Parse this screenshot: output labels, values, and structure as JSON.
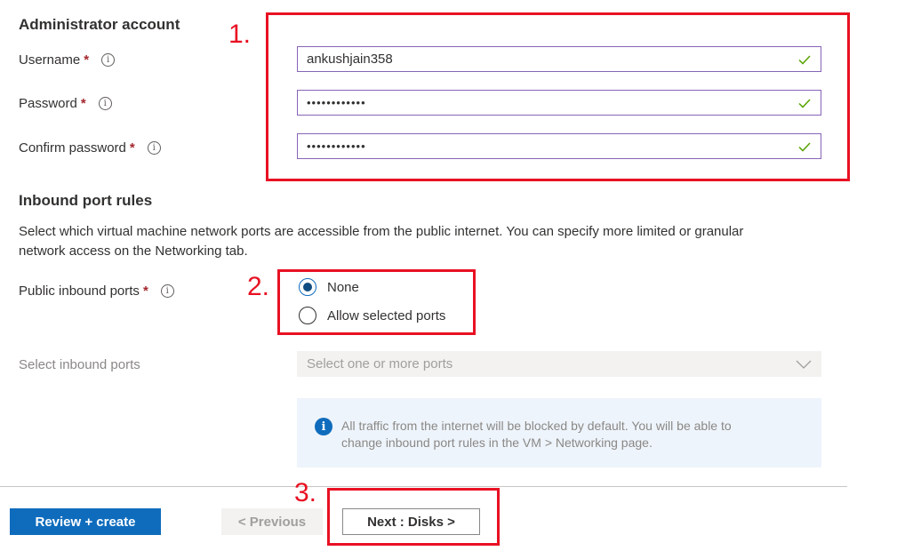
{
  "admin_account": {
    "title": "Administrator account",
    "username_label": "Username",
    "password_label": "Password",
    "confirm_label": "Confirm password",
    "required_mark": "*",
    "info_glyph": "i",
    "username_value": "ankushjain358",
    "password_value": "••••••••••••",
    "confirm_value": "••••••••••••",
    "valid_icon": "check-icon"
  },
  "inbound": {
    "title": "Inbound port rules",
    "description_line1": "Select which virtual machine network ports are accessible from the public internet. You can specify more limited or granular",
    "description_line2": "network access on the Networking tab.",
    "public_ports_label": "Public inbound ports",
    "options": [
      {
        "label": "None",
        "selected": true
      },
      {
        "label": "Allow selected ports",
        "selected": false
      }
    ],
    "select_label": "Select inbound ports",
    "select_placeholder": "Select one or more ports",
    "info_icon_glyph": "i",
    "info_line1": "All traffic from the internet will be blocked by default. You will be able to",
    "info_line2": "change inbound port rules in the VM > Networking page."
  },
  "annotations": {
    "num1": "1.",
    "num2": "2.",
    "num3": "3.",
    "color": "#e81123"
  },
  "footer": {
    "review_create": "Review + create",
    "previous": "< Previous",
    "next": "Next : Disks >"
  },
  "colors": {
    "primary": "#0f6cbd",
    "field_border": "#8764b8",
    "valid_check": "#57a300",
    "required": "#a4262c"
  }
}
